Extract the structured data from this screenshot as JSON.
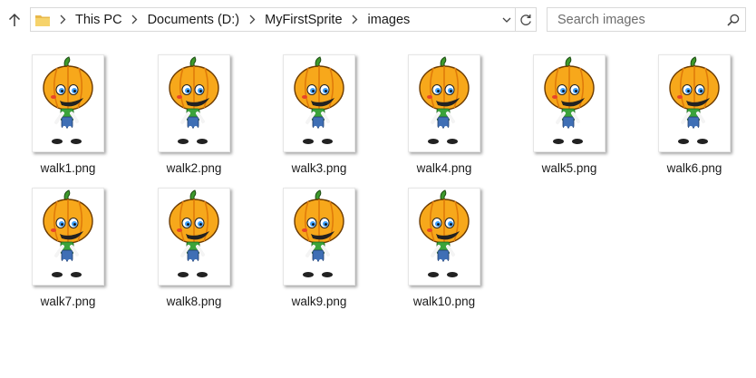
{
  "breadcrumbs": [
    "This PC",
    "Documents (D:)",
    "MyFirstSprite",
    "images"
  ],
  "search": {
    "placeholder": "Search images"
  },
  "files": [
    {
      "name": "walk1.png",
      "icon": "pumpkin-sprite-thumbnail"
    },
    {
      "name": "walk2.png",
      "icon": "pumpkin-sprite-thumbnail"
    },
    {
      "name": "walk3.png",
      "icon": "pumpkin-sprite-thumbnail"
    },
    {
      "name": "walk4.png",
      "icon": "pumpkin-sprite-thumbnail"
    },
    {
      "name": "walk5.png",
      "icon": "pumpkin-sprite-thumbnail"
    },
    {
      "name": "walk6.png",
      "icon": "pumpkin-sprite-thumbnail"
    },
    {
      "name": "walk7.png",
      "icon": "pumpkin-sprite-thumbnail"
    },
    {
      "name": "walk8.png",
      "icon": "pumpkin-sprite-thumbnail"
    },
    {
      "name": "walk9.png",
      "icon": "pumpkin-sprite-thumbnail"
    },
    {
      "name": "walk10.png",
      "icon": "pumpkin-sprite-thumbnail"
    }
  ],
  "colors": {
    "pumpkin": "#f7a81b",
    "pumpkin_shade": "#e07b0a",
    "stem": "#3e9a2c",
    "shirt": "#3aa33a",
    "overalls": "#3f6fb5",
    "accent_blue": "#3aa0ff"
  }
}
